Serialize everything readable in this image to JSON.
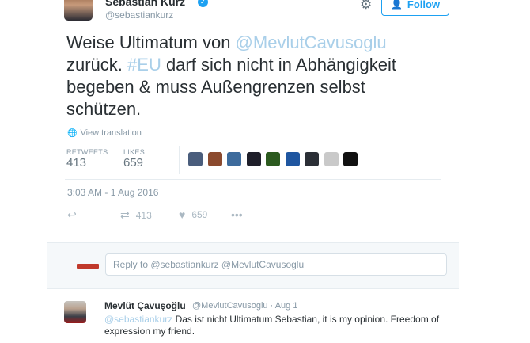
{
  "author": {
    "name": "Sebastian Kurz",
    "handle": "@sebastiankurz"
  },
  "header": {
    "follow_label": "Follow"
  },
  "tweet": {
    "text_part1": "Weise Ultimatum von ",
    "mention": "@MevlutCavusoglu",
    "text_part2": " zurück. ",
    "hashtag": "#EU",
    "text_part3": " darf sich nicht in Abhängigkeit begeben & muss Außengrenzen selbst schützen.",
    "translate_label": "View translation",
    "retweets_label": "RETWEETS",
    "retweets_count": "413",
    "likes_label": "LIKES",
    "likes_count": "659",
    "timestamp": "3:03 AM - 1 Aug 2016",
    "action_retweet_count": "413",
    "action_like_count": "659",
    "liker_avatar_colors": [
      "#4a5d7c",
      "#8b4a2e",
      "#3d6b9c",
      "#1f1f2a",
      "#2c5a1f",
      "#1f56a0",
      "#2b2f36",
      "#c9c9c9",
      "#111111"
    ]
  },
  "reply_box": {
    "placeholder": "Reply to @sebastiankurz @MevlutCavusoglu"
  },
  "reply": {
    "name": "Mevlüt Çavuşoğlu",
    "meta": "@MevlutCavusoglu · Aug 1",
    "mention": "@sebastiankurz",
    "text": " Das ist nicht Ultimatum Sebastian, it is my opinion. Freedom of expression my friend."
  }
}
